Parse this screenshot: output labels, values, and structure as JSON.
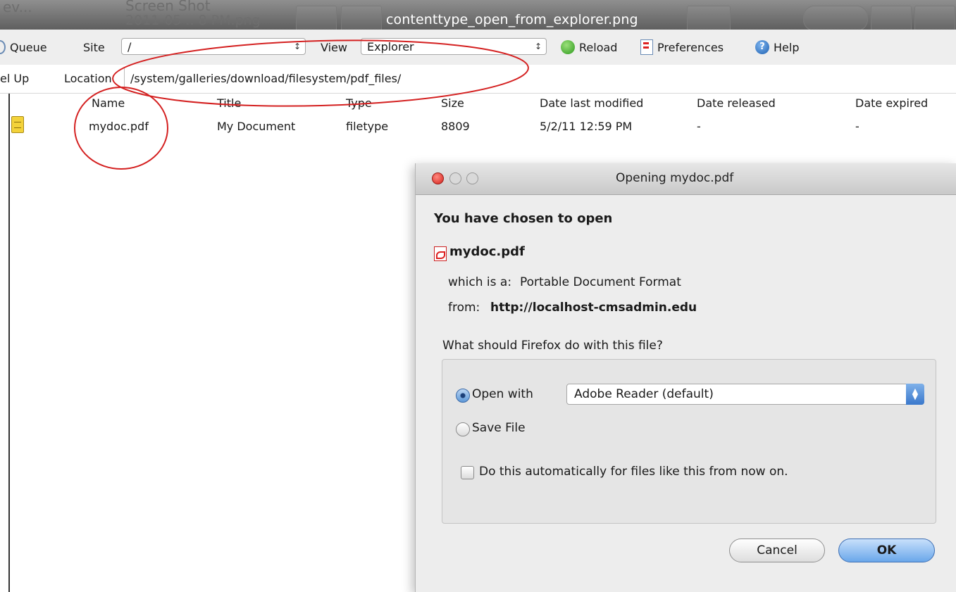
{
  "window": {
    "title": "contenttype_open_from_explorer.png",
    "ghost_text": [
      "ev...",
      "Screen Shot",
      "2011-05 .. 8 PM.png"
    ]
  },
  "toolbar": {
    "queue_label": "Queue",
    "site_label": "Site",
    "site_value": "/",
    "view_label": "View",
    "view_value": "Explorer",
    "reload_label": "Reload",
    "preferences_label": "Preferences",
    "help_label": "Help"
  },
  "location": {
    "up_label": "el Up",
    "label": "Location",
    "value": "/system/galleries/download/filesystem/pdf_files/"
  },
  "file_list": {
    "columns": [
      "Name",
      "Title",
      "Type",
      "Size",
      "Date last modified",
      "Date released",
      "Date expired"
    ],
    "rows": [
      {
        "name": "mydoc.pdf",
        "title": "My Document",
        "type": "filetype",
        "size": "8809",
        "modified": "5/2/11 12:59 PM",
        "released": "-",
        "expired": "-"
      }
    ]
  },
  "dialog": {
    "title": "Opening mydoc.pdf",
    "chosen_text": "You have chosen to open",
    "filename": "mydoc.pdf",
    "which_is_label": "which is a:",
    "which_is_value": "Portable Document Format",
    "from_label": "from:",
    "from_value": "http://localhost-cmsadmin.edu",
    "question": "What should Firefox do with this file?",
    "open_with_label": "Open with",
    "open_with_value": "Adobe Reader (default)",
    "save_file_label": "Save File",
    "auto_label": "Do this automatically for files like this from now on.",
    "cancel_label": "Cancel",
    "ok_label": "OK"
  },
  "colors": {
    "annotation": "#d42020",
    "titlebar": "#6e6e6e",
    "ok_button": "#6aa7ea"
  }
}
